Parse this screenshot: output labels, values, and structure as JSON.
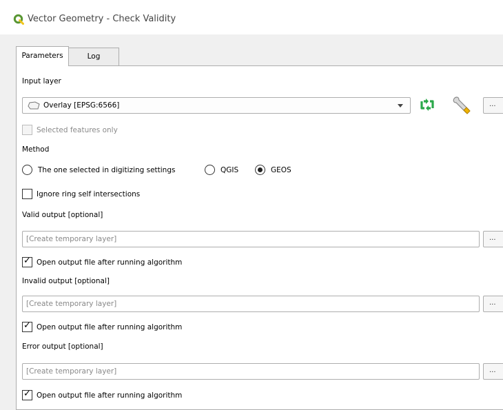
{
  "window": {
    "title": "Vector Geometry - Check Validity"
  },
  "tabs": [
    {
      "label": "Parameters",
      "active": true
    },
    {
      "label": "Log",
      "active": false
    }
  ],
  "input_layer": {
    "label": "Input layer",
    "value": "Overlay [EPSG:6566]",
    "browse_label": "...",
    "selected_only": {
      "label": "Selected features only",
      "checked": false,
      "enabled": false
    }
  },
  "method": {
    "label": "Method",
    "options": [
      {
        "label": "The one selected in digitizing settings",
        "selected": false
      },
      {
        "label": "QGIS",
        "selected": false
      },
      {
        "label": "GEOS",
        "selected": true
      }
    ]
  },
  "ignore_ring": {
    "label": "Ignore ring self intersections",
    "checked": false
  },
  "outputs": [
    {
      "label": "Valid output [optional]",
      "placeholder": "[Create temporary layer]",
      "browse_label": "...",
      "open_after": {
        "label": "Open output file after running algorithm",
        "checked": true
      }
    },
    {
      "label": "Invalid output [optional]",
      "placeholder": "[Create temporary layer]",
      "browse_label": "...",
      "open_after": {
        "label": "Open output file after running algorithm",
        "checked": true
      }
    },
    {
      "label": "Error output [optional]",
      "placeholder": "[Create temporary layer]",
      "browse_label": "...",
      "open_after": {
        "label": "Open output file after running algorithm",
        "checked": true
      }
    }
  ],
  "colors": {
    "qgis_green": "#589632",
    "iterate_green": "#2aa84a",
    "accent_border": "#adadad"
  },
  "icons": {
    "app": "qgis-logo-icon",
    "polygon": "polygon-layer-icon",
    "iterate": "iterate-icon",
    "settings": "wrench-icon"
  }
}
